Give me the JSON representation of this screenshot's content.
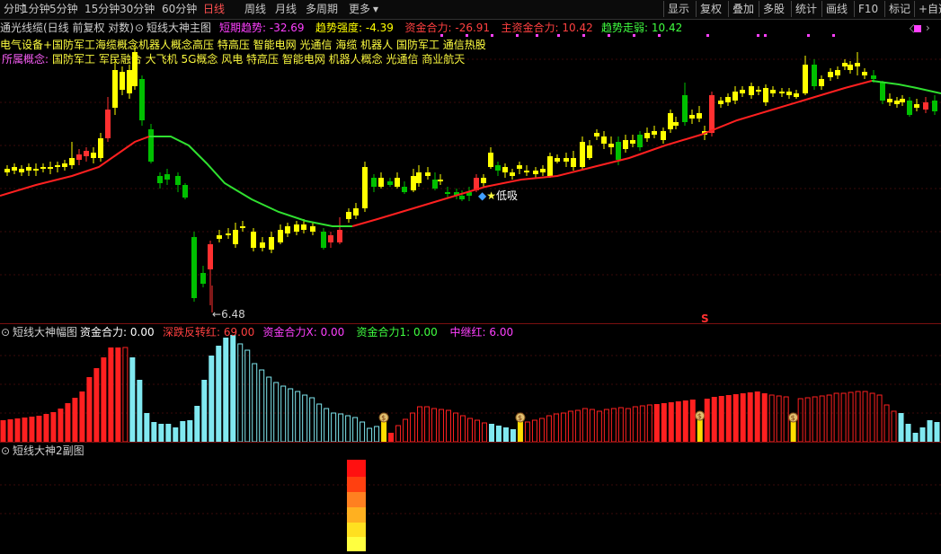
{
  "toolbar": {
    "periods": [
      "分时",
      "1分钟",
      "5分钟",
      "15分钟",
      "30分钟",
      "60分钟",
      "日线",
      "周线",
      "月线",
      "多周期",
      "更多"
    ],
    "active_period": "日线",
    "right_buttons": [
      "显示",
      "复权",
      "叠加",
      "多股",
      "统计",
      "画线",
      "F10",
      "标记",
      "+自选"
    ]
  },
  "main_panel": {
    "stock_label": "通光线缆(日线 前复权 对数)",
    "indicator_name": "短线大神主图",
    "fields": [
      {
        "name": "短期趋势",
        "value": "-32.69",
        "color": "#ff40ff"
      },
      {
        "name": "趋势强度",
        "value": "-4.39",
        "color": "#ffff00"
      },
      {
        "name": "资金合力",
        "value": "-26.91",
        "color": "#ff4040"
      },
      {
        "name": "主资金合力",
        "value": "10.42",
        "color": "#ff4040"
      },
      {
        "name": "趋势走弱",
        "value": "10.42",
        "color": "#40ff40"
      }
    ],
    "concept_line1": "电气设备+国防军工海缆概念机器人概念高压 特高压 智能电网 光通信 海缆 机器人 国防军工 通信热股",
    "concept_line2_label": "所属概念:",
    "concept_line2": "国防军工 军民融合 大飞机 5G概念 风电 特高压 智能电网 机器人概念 光通信 商业航天",
    "low_price_label": "6.48",
    "buy_signal_label": "低吸",
    "sell_marker": "S"
  },
  "sub_panel1": {
    "indicator_name": "短线大神幅图",
    "fields": [
      {
        "name": "资金合力",
        "value": "0.00",
        "color": "#ffffff"
      },
      {
        "name": "深跌反转红",
        "value": "69.00",
        "color": "#ff4040"
      },
      {
        "name": "资金合力X",
        "value": "0.00",
        "color": "#ff40ff"
      },
      {
        "name": "资金合力1",
        "value": "0.00",
        "color": "#40ff40"
      },
      {
        "name": "中继红",
        "value": "6.00",
        "color": "#ff40ff"
      }
    ]
  },
  "sub_panel2": {
    "indicator_name": "短线大神2副图"
  },
  "colors": {
    "up": "#ffff00",
    "up_red": "#ff3030",
    "down": "#00c000",
    "ma_up": "#ff2020",
    "ma_down": "#30e030",
    "bar_red": "#ff2020",
    "bar_cyan": "#80e8f0",
    "bar_yellow": "#ffdd00"
  }
}
